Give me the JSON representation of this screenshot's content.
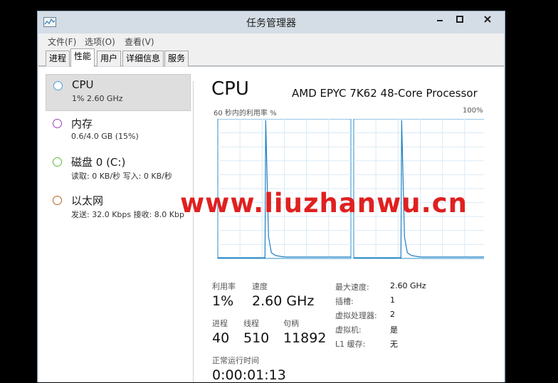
{
  "window": {
    "title": "任务管理器"
  },
  "menu": [
    "文件(F)",
    "选项(O)",
    "查看(V)"
  ],
  "tabs": [
    "进程",
    "性能",
    "用户",
    "详细信息",
    "服务"
  ],
  "active_tab": "性能",
  "sidebar": {
    "items": [
      {
        "title": "CPU",
        "sub": "1% 2.60 GHz",
        "color": "#4a9fd8"
      },
      {
        "title": "内存",
        "sub": "0.6/4.0 GB (15%)",
        "color": "#9b3fb5"
      },
      {
        "title": "磁盘 0 (C:)",
        "sub": "读取: 0 KB/秒 写入: 0 KB/秒",
        "color": "#5cb83a"
      },
      {
        "title": "以太网",
        "sub": "发送: 32.0 Kbps 接收: 8.0 Kbp",
        "color": "#b5651d"
      }
    ]
  },
  "detail": {
    "heading": "CPU",
    "model": "AMD EPYC 7K62 48-Core Processor",
    "graph_label": "60 秒内的利用率 %",
    "graph_max": "100%",
    "stats": {
      "util_label": "利用率",
      "util_value": "1%",
      "speed_label": "速度",
      "speed_value": "2.60 GHz",
      "proc_label": "进程",
      "proc_value": "40",
      "thread_label": "线程",
      "thread_value": "510",
      "handle_label": "句柄",
      "handle_value": "11892",
      "uptime_label": "正常运行时间",
      "uptime_value": "0:00:01:13"
    },
    "kv": [
      {
        "label": "最大速度:",
        "value": "2.60 GHz"
      },
      {
        "label": "插槽:",
        "value": "1"
      },
      {
        "label": "虚拟处理器:",
        "value": "2"
      },
      {
        "label": "虚拟机:",
        "value": "是"
      },
      {
        "label": "L1 缓存:",
        "value": "无"
      }
    ]
  },
  "chart_data": {
    "type": "line",
    "title": "60 秒内的利用率 %",
    "ylim": [
      0,
      100
    ],
    "series": [
      {
        "x": [
          0,
          5,
          10,
          12,
          14,
          16,
          18,
          20,
          22,
          24,
          26,
          30,
          35,
          40,
          45,
          50,
          55,
          60
        ],
        "values": [
          0,
          0,
          0,
          0,
          0,
          0,
          0,
          0,
          0,
          0,
          0,
          0,
          0,
          0,
          0,
          0,
          0,
          0
        ]
      },
      {
        "x": [
          0,
          5,
          10,
          12,
          14,
          16,
          18,
          20,
          22,
          24,
          26,
          30,
          35,
          40,
          45,
          50,
          55,
          60
        ],
        "values": [
          0,
          0,
          0,
          0,
          0,
          0,
          0,
          0,
          0,
          0,
          0,
          0,
          0,
          0,
          0,
          0,
          0,
          0
        ]
      }
    ]
  },
  "watermark": "www.liuzhanwu.cn"
}
